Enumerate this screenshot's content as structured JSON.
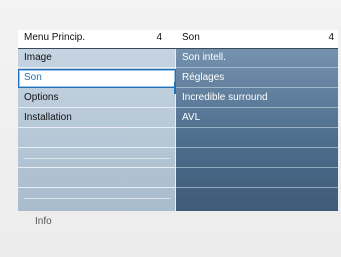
{
  "left_menu": {
    "title": "Menu Princip.",
    "count": "4",
    "items": [
      {
        "label": "Image"
      },
      {
        "label": "Son"
      },
      {
        "label": "Options"
      },
      {
        "label": "Installation"
      }
    ],
    "selected_index": 1
  },
  "right_menu": {
    "title": "Son",
    "count": "4",
    "items": [
      {
        "label": "Son intell."
      },
      {
        "label": "Réglages"
      },
      {
        "label": "Incredible surround"
      },
      {
        "label": "AVL"
      }
    ]
  },
  "info_label": "Info",
  "colors": {
    "accent": "#1f70b8",
    "left_panel": "#b8c8d8",
    "right_panel": "#5a7a99"
  }
}
